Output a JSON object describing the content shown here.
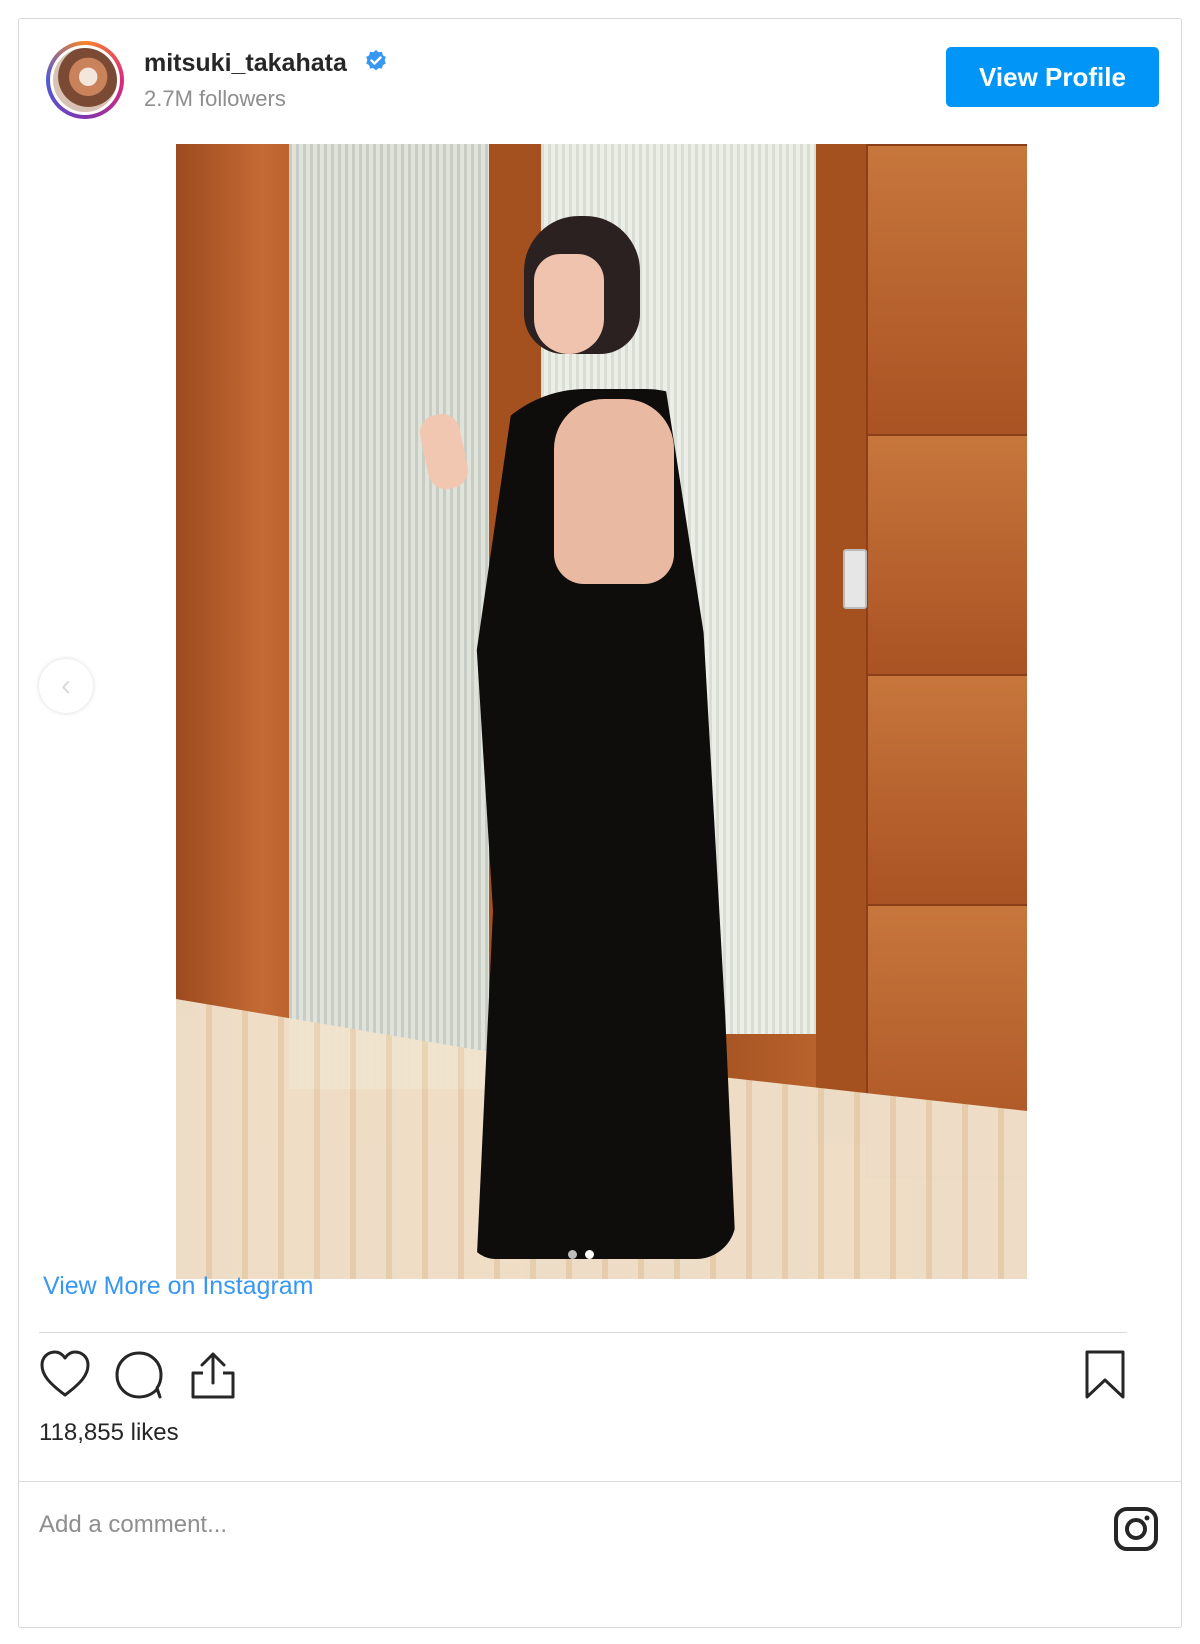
{
  "header": {
    "username": "mitsuki_takahata",
    "followers": "2.7M followers",
    "view_profile_label": "View Profile"
  },
  "post": {
    "carousel_total": 2,
    "carousel_active_index": 1,
    "view_more_label": "View More on Instagram",
    "likes": "118,855 likes",
    "comment_placeholder": "Add a comment..."
  },
  "icons": {
    "verified": "verified-badge-icon",
    "like": "heart-icon",
    "comment": "speech-bubble-icon",
    "share": "share-upload-icon",
    "save": "bookmark-icon",
    "brand": "instagram-icon",
    "prev": "chevron-left-icon"
  },
  "colors": {
    "accent": "#0095f6",
    "link": "#3897f0",
    "muted": "#8e8e8e"
  }
}
